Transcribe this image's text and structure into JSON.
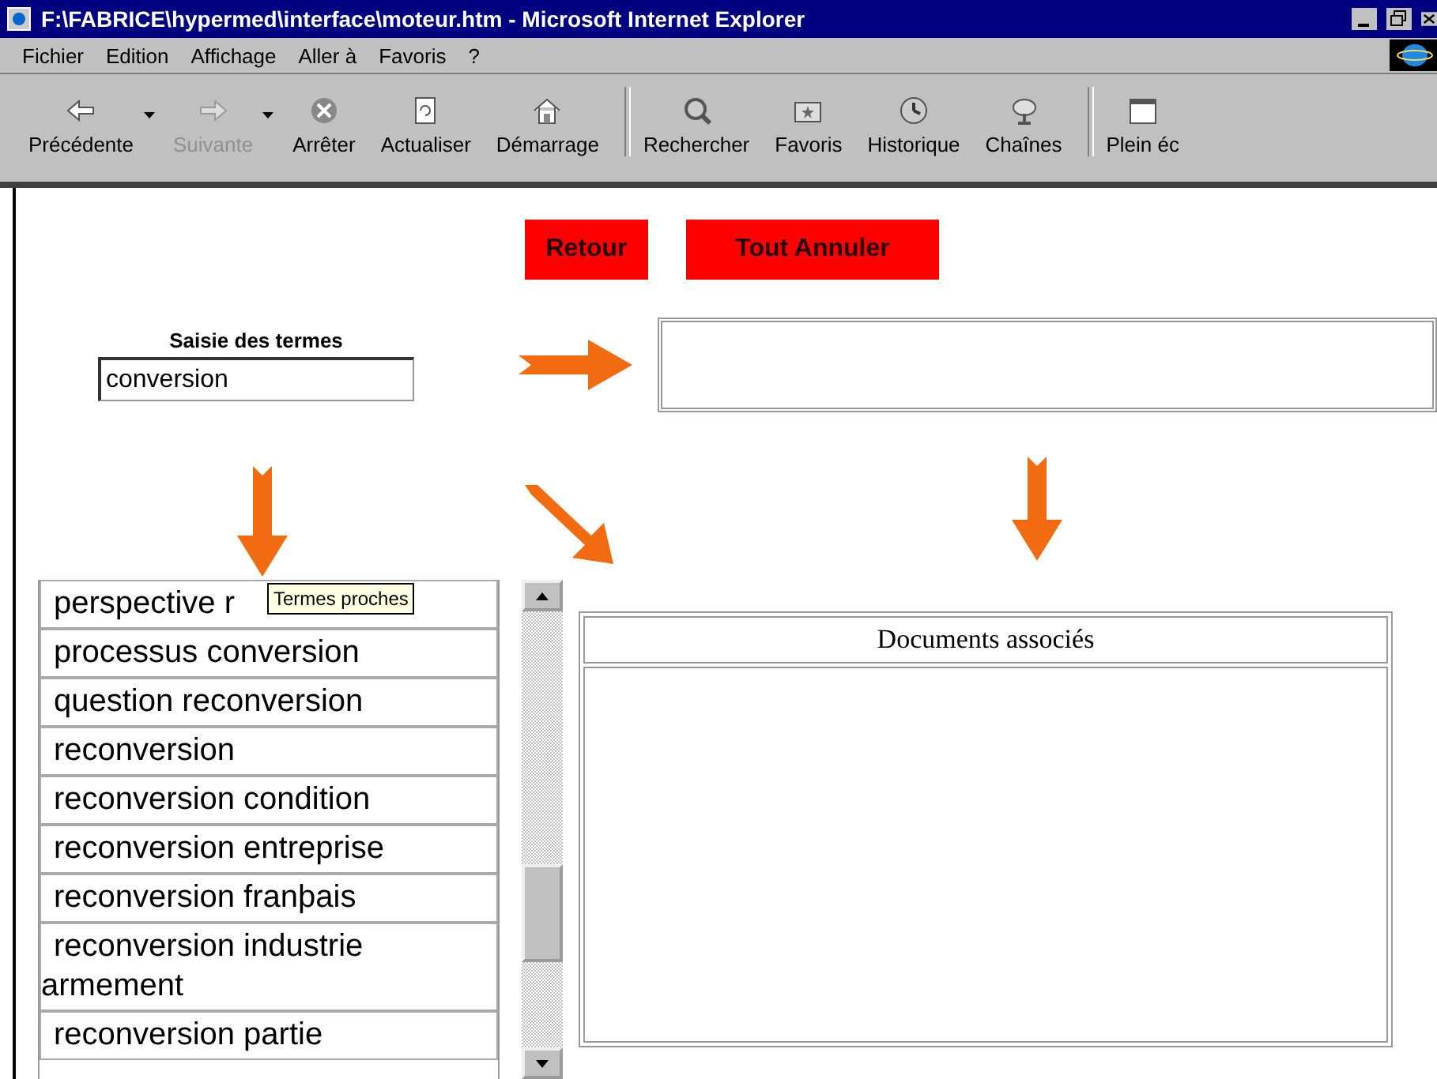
{
  "window": {
    "title": "F:\\FABRICE\\hypermed\\interface\\moteur.htm - Microsoft Internet Explorer"
  },
  "menu": [
    "Fichier",
    "Edition",
    "Affichage",
    "Aller à",
    "Favoris",
    "?"
  ],
  "toolbar": [
    {
      "label": "Précédente",
      "disabled": false,
      "dropdown": true
    },
    {
      "label": "Suivante",
      "disabled": true,
      "dropdown": true
    },
    {
      "label": "Arrêter",
      "disabled": false,
      "dropdown": false
    },
    {
      "label": "Actualiser",
      "disabled": false,
      "dropdown": false
    },
    {
      "label": "Démarrage",
      "disabled": false,
      "dropdown": false
    },
    {
      "label": "Rechercher",
      "disabled": false,
      "dropdown": false
    },
    {
      "label": "Favoris",
      "disabled": false,
      "dropdown": false
    },
    {
      "label": "Historique",
      "disabled": false,
      "dropdown": false
    },
    {
      "label": "Chaînes",
      "disabled": false,
      "dropdown": false
    },
    {
      "label": "Plein éc",
      "disabled": false,
      "dropdown": false
    }
  ],
  "buttons": [
    "Retour",
    "Tout Annuler"
  ],
  "search": {
    "label": "Saisie des termes",
    "value": "conversion"
  },
  "terms": [
    "perspective r",
    "processus conversion",
    "question reconversion",
    "reconversion",
    "reconversion condition",
    "reconversion entreprise",
    "reconversion franþais",
    "reconversion industrie armement",
    "reconversion partie"
  ],
  "tooltip": "Termes proches",
  "documents": {
    "header": "Documents associés"
  }
}
